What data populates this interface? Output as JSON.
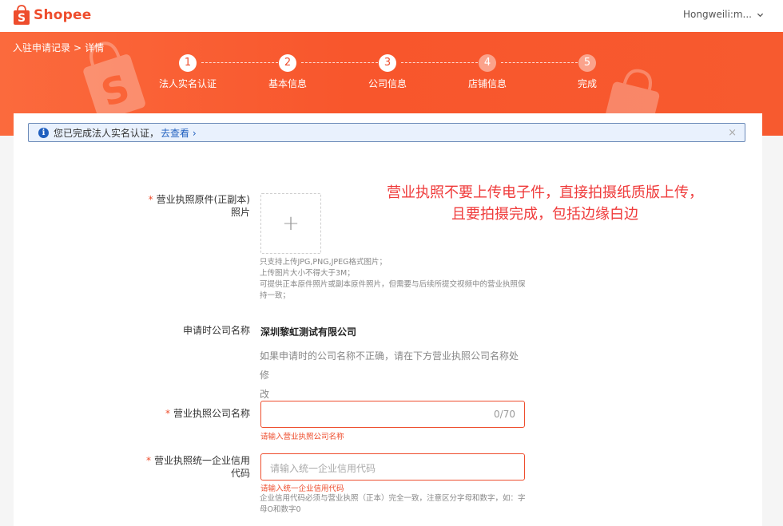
{
  "header": {
    "brand": "Shopee",
    "user": "Hongweili:m..."
  },
  "breadcrumb": {
    "parent": "入驻申请记录",
    "separator": ">",
    "current": "详情"
  },
  "steps": [
    {
      "num": "1",
      "label": "法人实名认证",
      "state": "active"
    },
    {
      "num": "2",
      "label": "基本信息",
      "state": "active"
    },
    {
      "num": "3",
      "label": "公司信息",
      "state": "active"
    },
    {
      "num": "4",
      "label": "店铺信息",
      "state": "inactive"
    },
    {
      "num": "5",
      "label": "完成",
      "state": "inactive"
    }
  ],
  "notice": {
    "text": "您已完成法人实名认证，",
    "link": "去查看 ›",
    "close": "×"
  },
  "annotation": {
    "line1": "营业执照不要上传电子件，直接拍摄纸质版上传，",
    "line2": "且要拍摄完成，包括边缘白边"
  },
  "license_photo": {
    "required_mark": "*",
    "label_line1": "营业执照原件(正副本)",
    "label_line2": "照片",
    "plus": "+",
    "hint1": "只支持上传JPG,PNG,JPEG格式图片；",
    "hint2": "上传图片大小不得大于3M；",
    "hint3": "可提供正本原件照片或副本原件照片，但需要与后续所提交视频中的营业执照保",
    "hint4": "持一致；"
  },
  "apply_company": {
    "label": "申请时公司名称",
    "value": "深圳黎虹测试有限公司",
    "help1": "如果申请时的公司名称不正确，请在下方营业执照公司名称处修",
    "help2": "改"
  },
  "license_company": {
    "required_mark": "*",
    "label": "营业执照公司名称",
    "value": "",
    "counter": "0/70",
    "error": "请输入营业执照公司名称"
  },
  "credit_code": {
    "required_mark": "*",
    "label_line1": "营业执照统一企业信用",
    "label_line2": "代码",
    "placeholder": "请输入统一企业信用代码",
    "error": "请输入统一企业信用代码",
    "hint1": "企业信用代码必须与营业执照（正本）完全一致，注意区分字母和数字，如：字",
    "hint2": "母O和数字0"
  },
  "colors": {
    "brand": "#ee4d2d",
    "banner": "#f8562c",
    "notice_border": "#6b8ab8",
    "link": "#1f5fbf",
    "annotation": "#ef3b3b"
  }
}
